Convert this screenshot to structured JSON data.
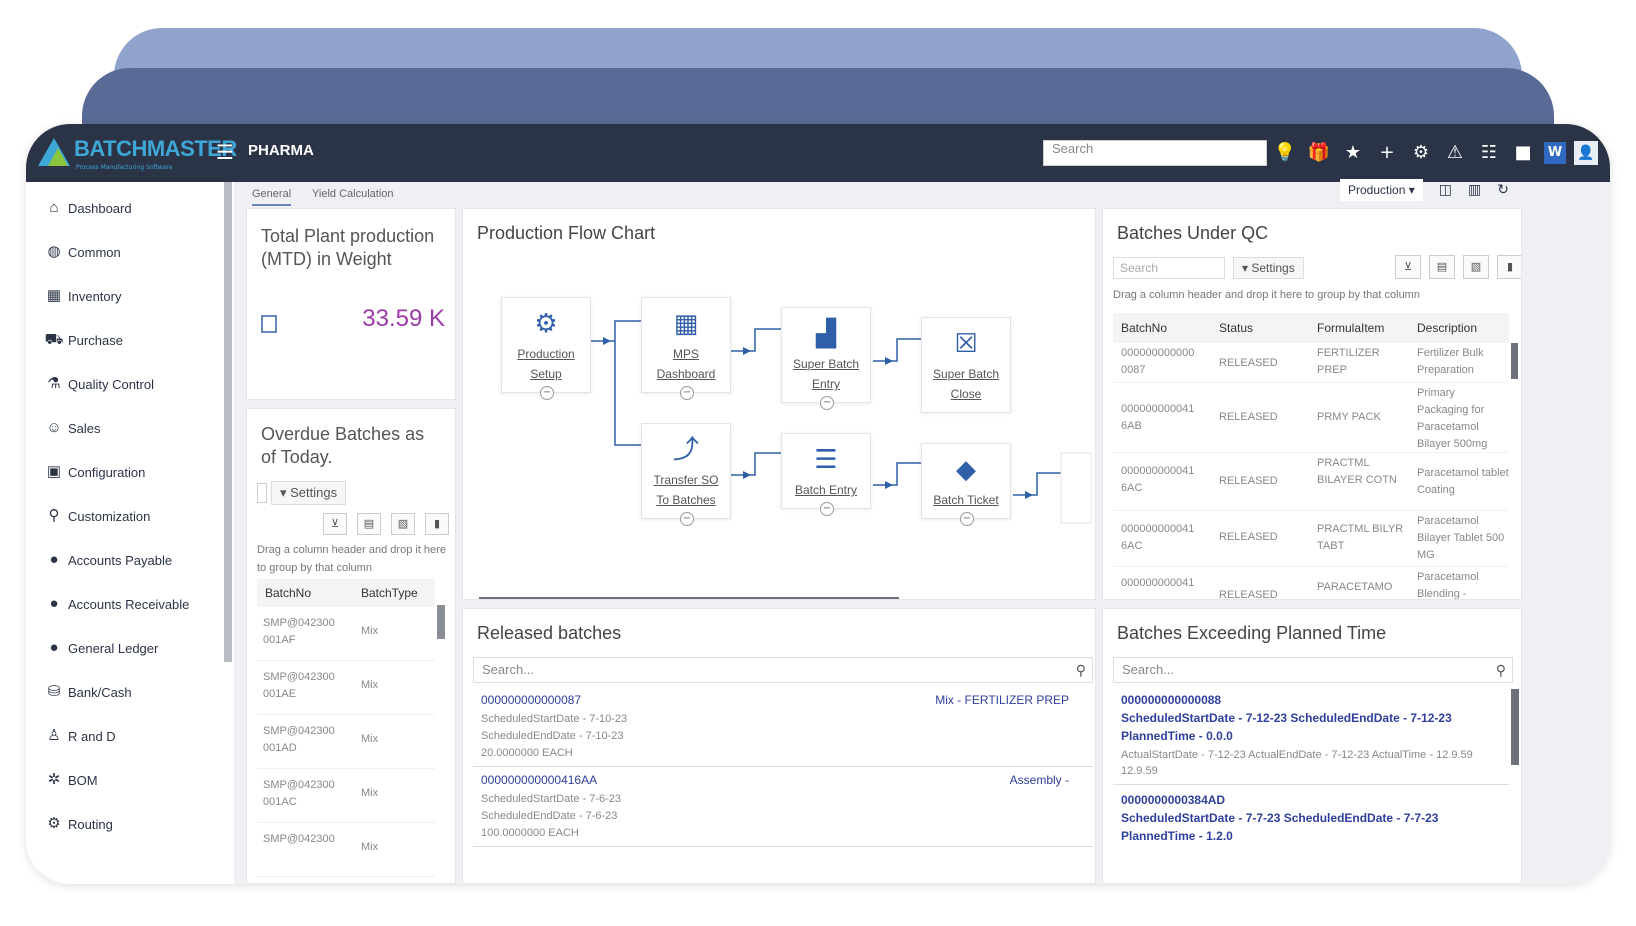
{
  "header": {
    "brand": "BATCHMASTER",
    "brand_tag": "Process Manufacturing Software",
    "app_name": "PHARMA",
    "search_placeholder": "Search"
  },
  "sidebar": {
    "items": [
      {
        "label": "Dashboard",
        "icon": "home-icon"
      },
      {
        "label": "Common",
        "icon": "globe-icon"
      },
      {
        "label": "Inventory",
        "icon": "warehouse-icon"
      },
      {
        "label": "Purchase",
        "icon": "cart-icon"
      },
      {
        "label": "Quality Control",
        "icon": "flask-icon"
      },
      {
        "label": "Sales",
        "icon": "user-dollar-icon"
      },
      {
        "label": "Configuration",
        "icon": "config-icon"
      },
      {
        "label": "Customization",
        "icon": "search-gear-icon"
      },
      {
        "label": "Accounts Payable",
        "icon": "ap-icon"
      },
      {
        "label": "Accounts Receivable",
        "icon": "ar-icon"
      },
      {
        "label": "General Ledger",
        "icon": "gl-icon"
      },
      {
        "label": "Bank/Cash",
        "icon": "bank-icon"
      },
      {
        "label": "R and D",
        "icon": "microscope-icon"
      },
      {
        "label": "BOM",
        "icon": "bom-icon"
      },
      {
        "label": "Routing",
        "icon": "gear-icon"
      }
    ]
  },
  "tabs": [
    {
      "label": "General"
    },
    {
      "label": "Yield Calculation"
    }
  ],
  "toolbar": {
    "module_select": "Production"
  },
  "total_plant": {
    "title": "Total Plant production (MTD) in Weight",
    "value": "33.59 K"
  },
  "overdue": {
    "title": "Overdue Batches as of Today.",
    "settings_label": "Settings",
    "drag_hint": "Drag a column header and drop it here to group by that column",
    "columns": [
      "BatchNo",
      "BatchType"
    ],
    "rows": [
      {
        "batch": "SMP@042300 001AF",
        "type": "Mix"
      },
      {
        "batch": "SMP@042300 001AE",
        "type": "Mix"
      },
      {
        "batch": "SMP@042300 001AD",
        "type": "Mix"
      },
      {
        "batch": "SMP@042300 001AC",
        "type": "Mix"
      },
      {
        "batch": "SMP@042300",
        "type": "Mix"
      }
    ]
  },
  "flow": {
    "title": "Production Flow Chart",
    "nodes": [
      {
        "label": "Production Setup",
        "icon": "gears-icon"
      },
      {
        "label": "MPS Dashboard",
        "icon": "calendar-icon"
      },
      {
        "label": "Super Batch Entry",
        "icon": "factory-icon"
      },
      {
        "label": "Super Batch Close",
        "icon": "close-box-icon"
      },
      {
        "label": "Transfer SO To Batches",
        "icon": "share-icon"
      },
      {
        "label": "Batch Entry",
        "icon": "list-icon"
      },
      {
        "label": "Batch Ticket",
        "icon": "ticket-icon"
      }
    ]
  },
  "qc": {
    "title": "Batches Under QC",
    "search_placeholder": "Search",
    "settings_label": "Settings",
    "drag_hint": "Drag a column header and drop it here to group by that column",
    "columns": [
      "BatchNo",
      "Status",
      "FormulaItem",
      "Description"
    ],
    "rows": [
      {
        "batch": "000000000000 0087",
        "status": "RELEASED",
        "formula": "FERTILIZER PREP",
        "desc": "Fertilizer Bulk Preparation"
      },
      {
        "batch": "000000000041 6AB",
        "status": "RELEASED",
        "formula": "PRMY PACK",
        "desc": "Primary Packaging for Paracetamol Bilayer 500mg"
      },
      {
        "batch": "000000000041 6AC",
        "status": "RELEASED",
        "formula": "PRACTML BILAYER COTN",
        "desc": "Paracetamol tablet Coating"
      },
      {
        "batch": "000000000041 6AC",
        "status": "RELEASED",
        "formula": "PRACTML BILYR TABT",
        "desc": "Paracetamol Bilayer Tablet 500 MG"
      },
      {
        "batch": "000000000041",
        "status": "RELEASED",
        "formula": "PARACETAMO",
        "desc": "Paracetamol Blending -"
      }
    ]
  },
  "released": {
    "title": "Released batches",
    "search_placeholder": "Search...",
    "items": [
      {
        "no": "000000000000087",
        "tag": "Mix - FERTILIZER PREP",
        "start": "ScheduledStartDate - 7-10-23",
        "end": "ScheduledEndDate - 7-10-23",
        "qty": "20.0000000 EACH"
      },
      {
        "no": "000000000000416AA",
        "tag": "Assembly -",
        "start": "ScheduledStartDate - 7-6-23",
        "end": "ScheduledEndDate - 7-6-23",
        "qty": "100.0000000 EACH"
      }
    ]
  },
  "exceeding": {
    "title": "Batches Exceeding Planned Time",
    "search_placeholder": "Search...",
    "items": [
      {
        "no": "000000000000088",
        "sched": "ScheduledStartDate - 7-12-23 ScheduledEndDate - 7-12-23",
        "planned": "PlannedTime - 0.0.0",
        "actual": "ActualStartDate - 7-12-23 ActualEndDate - 7-12-23 ActualTime - 12.9.59",
        "actual2": "12.9.59"
      },
      {
        "no": "0000000000384AD",
        "sched": "ScheduledStartDate - 7-7-23 ScheduledEndDate - 7-7-23",
        "planned": "PlannedTime - 1.2.0"
      }
    ]
  }
}
